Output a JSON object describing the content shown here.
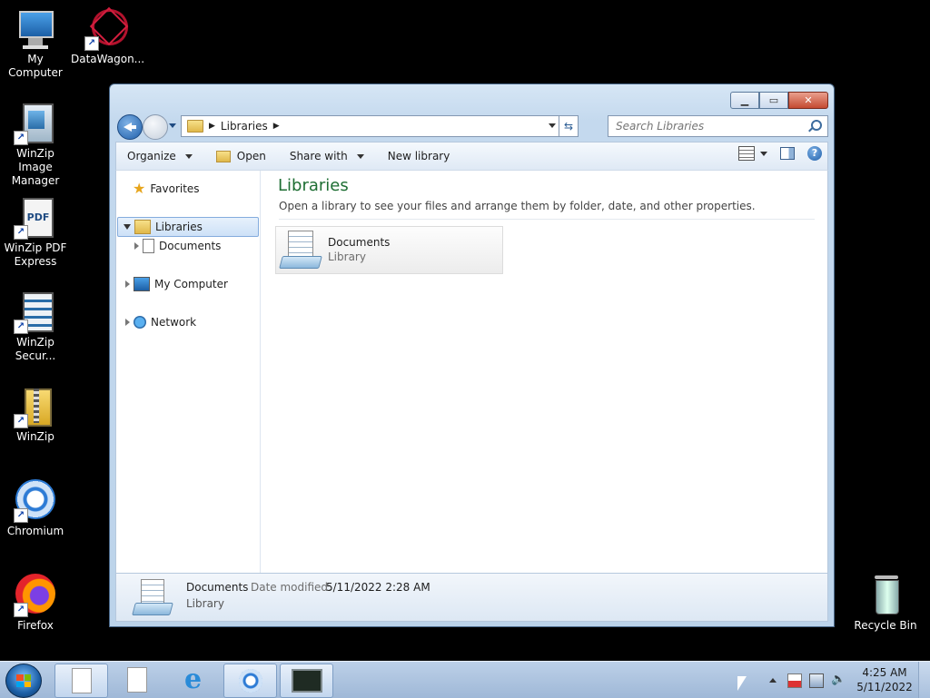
{
  "desktop": {
    "icons": [
      {
        "label": "My Computer",
        "icon": "computer-icon"
      },
      {
        "label": "DataWagon...",
        "icon": "datawagon-icon"
      },
      {
        "label": "WinZip Image Manager",
        "icon": "winzip-image-manager-icon"
      },
      {
        "label": "WinZip PDF Express",
        "icon": "winzip-pdf-express-icon"
      },
      {
        "label": "WinZip Secur...",
        "icon": "winzip-secure-icon"
      },
      {
        "label": "WinZip",
        "icon": "winzip-icon"
      },
      {
        "label": "Chromium",
        "icon": "chromium-icon"
      },
      {
        "label": "Firefox",
        "icon": "firefox-icon"
      },
      {
        "label": "Recycle Bin",
        "icon": "recycle-bin-icon"
      }
    ]
  },
  "window": {
    "address": {
      "crumb": "Libraries"
    },
    "search": {
      "placeholder": "Search Libraries"
    },
    "toolbar": {
      "organize": "Organize",
      "open": "Open",
      "share_with": "Share with",
      "new_library": "New library"
    },
    "nav": {
      "favorites": "Favorites",
      "libraries": "Libraries",
      "documents": "Documents",
      "my_computer": "My Computer",
      "network": "Network"
    },
    "content": {
      "title": "Libraries",
      "subtitle": "Open a library to see your files and arrange them by folder, date, and other properties.",
      "items": [
        {
          "name": "Documents",
          "kind": "Library"
        }
      ]
    },
    "details": {
      "name": "Documents",
      "modified_label": "Date modified:",
      "modified": "5/11/2022 2:28 AM",
      "kind": "Library"
    }
  },
  "taskbar": {
    "time": "4:25 AM",
    "date": "5/11/2022"
  }
}
